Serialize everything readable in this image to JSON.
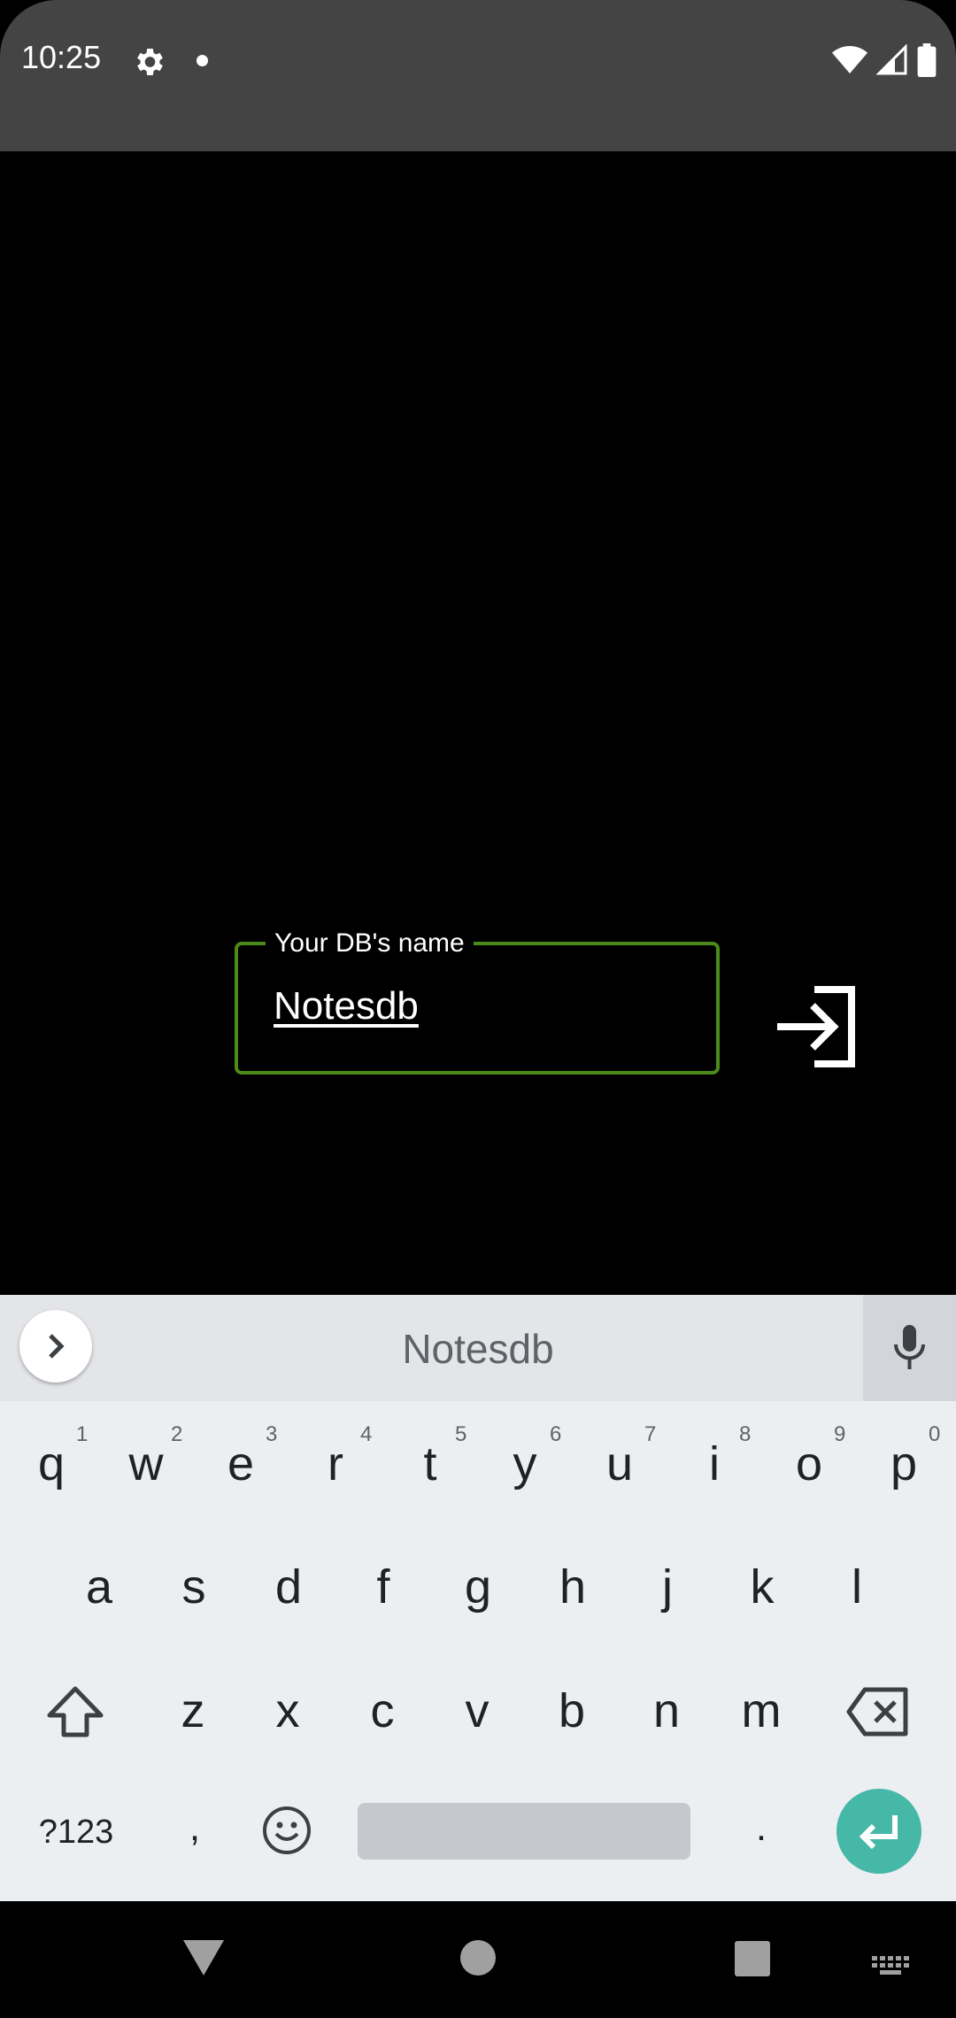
{
  "status_bar": {
    "time": "10:25"
  },
  "db_field": {
    "label": "Your DB's name",
    "value": "Notesdb"
  },
  "keyboard": {
    "suggestion": "Notesdb",
    "row1": [
      "q",
      "w",
      "e",
      "r",
      "t",
      "y",
      "u",
      "i",
      "o",
      "p"
    ],
    "row1_hints": [
      "1",
      "2",
      "3",
      "4",
      "5",
      "6",
      "7",
      "8",
      "9",
      "0"
    ],
    "row2": [
      "a",
      "s",
      "d",
      "f",
      "g",
      "h",
      "j",
      "k",
      "l"
    ],
    "row3": [
      "z",
      "x",
      "c",
      "v",
      "b",
      "n",
      "m"
    ],
    "symbols_label": "?123",
    "comma": ",",
    "period": "."
  },
  "colors": {
    "status_bar": "#444444",
    "field_border": "#4c8a1a",
    "enter": "#45b8a8"
  }
}
